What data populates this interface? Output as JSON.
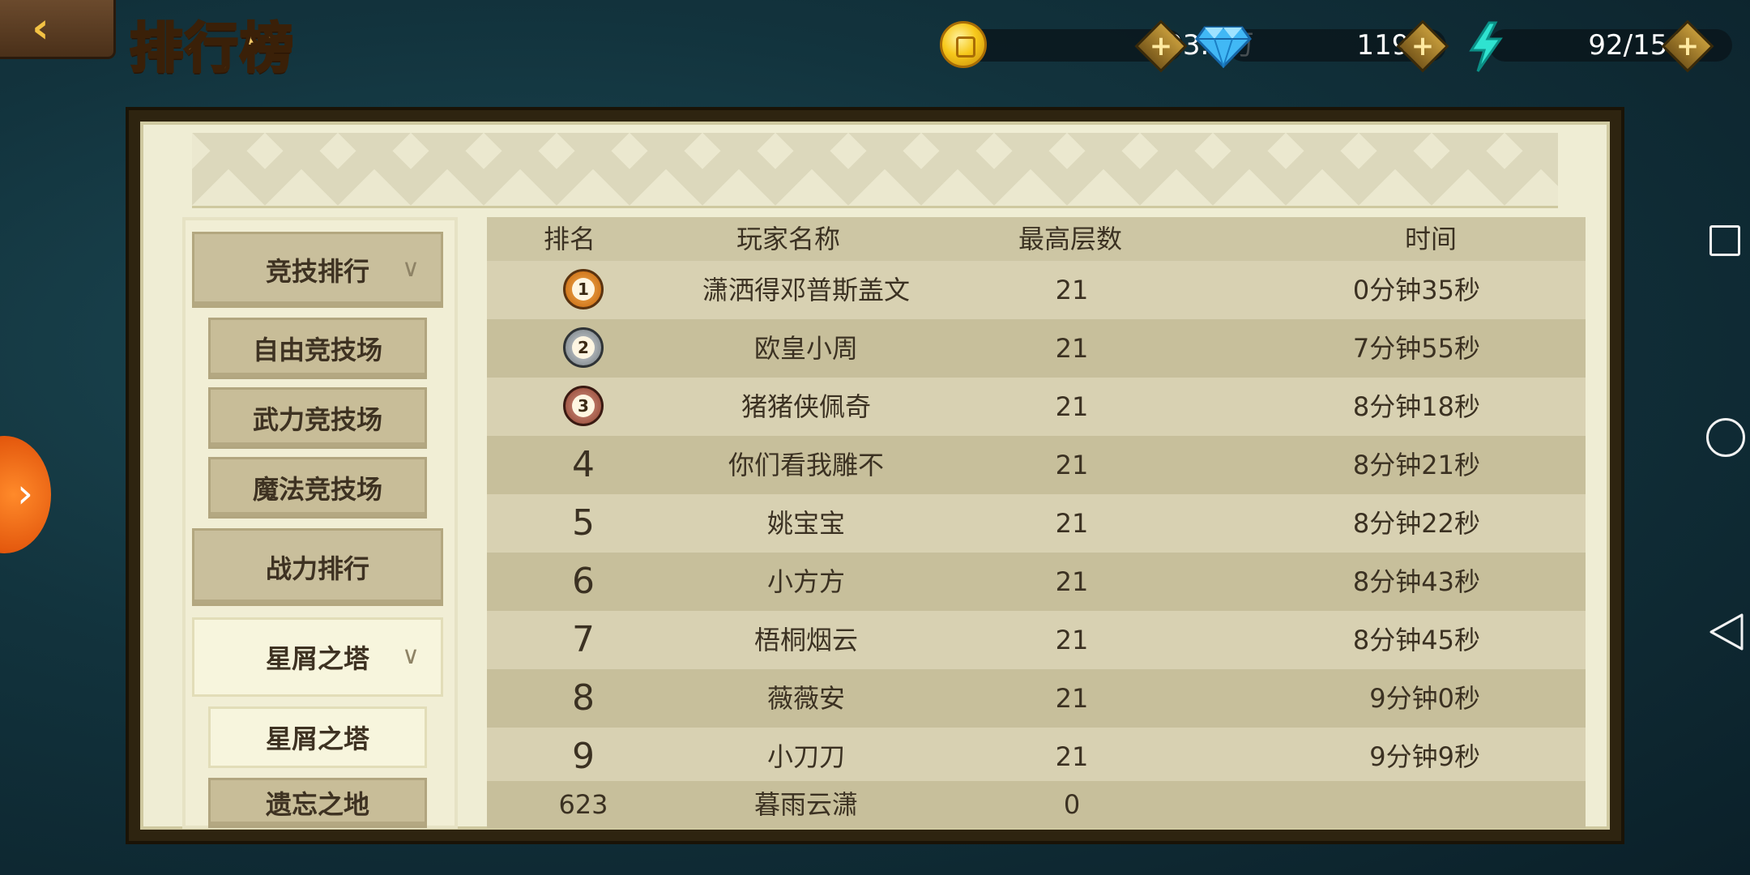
{
  "header": {
    "back_icon": "back-arrow-icon",
    "title": "排行榜"
  },
  "resources": {
    "gold": "293.8万",
    "diamonds": "1197",
    "energy": "92/150"
  },
  "menu": {
    "items": [
      {
        "label": "竞技排行",
        "type": "category",
        "expanded": true
      },
      {
        "label": "自由竞技场",
        "type": "sub"
      },
      {
        "label": "武力竞技场",
        "type": "sub"
      },
      {
        "label": "魔法竞技场",
        "type": "sub"
      },
      {
        "label": "战力排行",
        "type": "category"
      },
      {
        "label": "星屑之塔",
        "type": "category",
        "expanded": true,
        "selected": true
      },
      {
        "label": "星屑之塔",
        "type": "sub",
        "selected": true
      },
      {
        "label": "遗忘之地",
        "type": "sub"
      }
    ]
  },
  "table": {
    "columns": [
      "排名",
      "玩家名称",
      "最高层数",
      "时间"
    ],
    "rows": [
      {
        "rank": "1",
        "name": "潇洒得邓普斯盖文",
        "floor": "21",
        "time": "0分钟35秒"
      },
      {
        "rank": "2",
        "name": "欧皇小周",
        "floor": "21",
        "time": "7分钟55秒"
      },
      {
        "rank": "3",
        "name": "猪猪侠佩奇",
        "floor": "21",
        "time": "8分钟18秒"
      },
      {
        "rank": "4",
        "name": "你们看我雕不",
        "floor": "21",
        "time": "8分钟21秒"
      },
      {
        "rank": "5",
        "name": "姚宝宝",
        "floor": "21",
        "time": "8分钟22秒"
      },
      {
        "rank": "6",
        "name": "小方方",
        "floor": "21",
        "time": "8分钟43秒"
      },
      {
        "rank": "7",
        "name": "梧桐烟云",
        "floor": "21",
        "time": "8分钟45秒"
      },
      {
        "rank": "8",
        "name": "薇薇安",
        "floor": "21",
        "time": "9分钟0秒"
      },
      {
        "rank": "9",
        "name": "小刀刀",
        "floor": "21",
        "time": "9分钟9秒"
      }
    ],
    "my_row": {
      "rank": "623",
      "name": "暮雨云潇",
      "floor": "0",
      "time": ""
    }
  }
}
